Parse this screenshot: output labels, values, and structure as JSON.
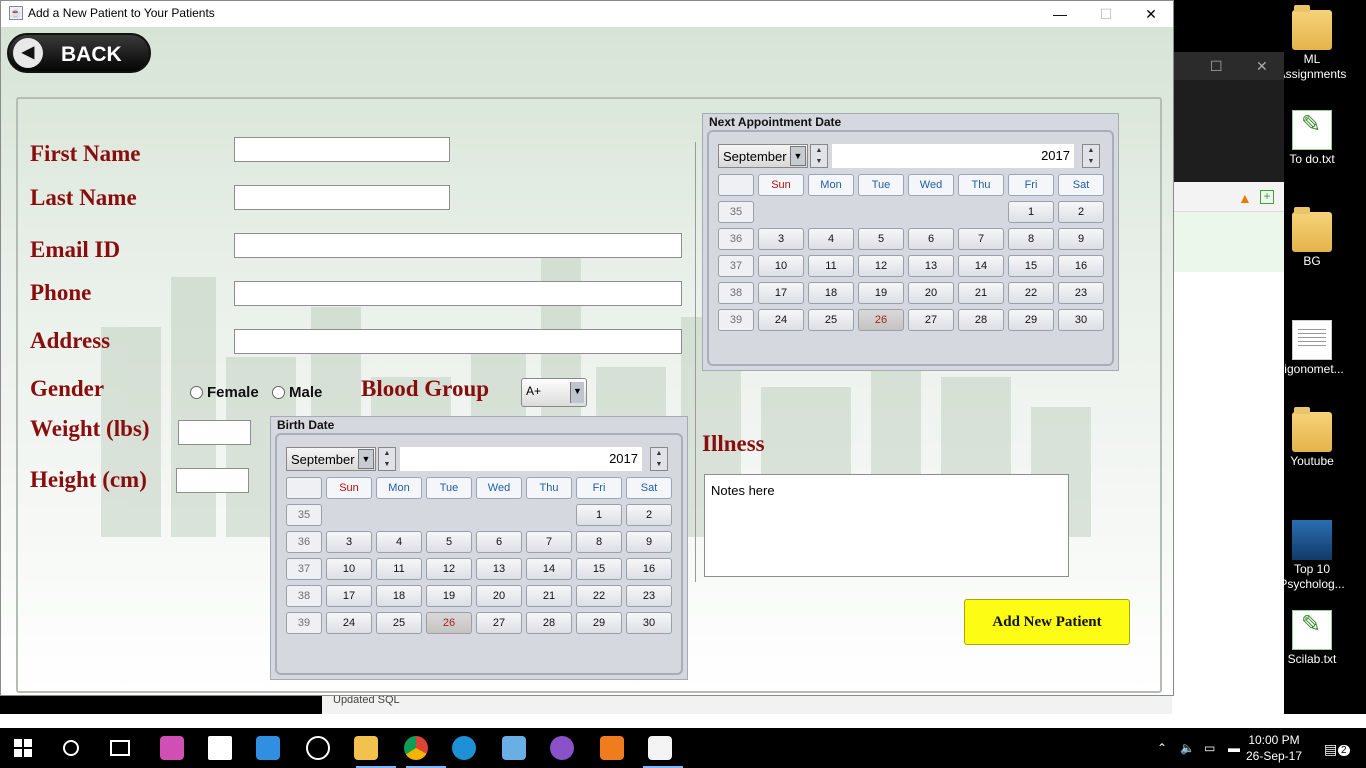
{
  "window": {
    "title": "Add a New Patient to Your Patients",
    "minimize": "—",
    "maximize": "☐",
    "close": "✕"
  },
  "back_label": "BACK",
  "form": {
    "first_name_label": "First Name",
    "last_name_label": "Last Name",
    "email_label": "Email ID",
    "phone_label": "Phone",
    "address_label": "Address",
    "gender_label": "Gender",
    "gender_options": [
      "Female",
      "Male"
    ],
    "blood_group_label": "Blood Group",
    "blood_group_value": "A+",
    "weight_label": "Weight (lbs)",
    "height_label": "Height (cm)",
    "first_name_value": "",
    "last_name_value": "",
    "email_value": "",
    "phone_value": "",
    "address_value": "",
    "weight_value": "",
    "height_value": ""
  },
  "birth_calendar": {
    "title": "Birth Date",
    "month": "September",
    "year": "2017",
    "weekdays": [
      "Sun",
      "Mon",
      "Tue",
      "Wed",
      "Thu",
      "Fri",
      "Sat"
    ],
    "weeks": [
      {
        "num": "35",
        "days": [
          "",
          "",
          "",
          "",
          "",
          "1",
          "2"
        ]
      },
      {
        "num": "36",
        "days": [
          "3",
          "4",
          "5",
          "6",
          "7",
          "8",
          "9"
        ]
      },
      {
        "num": "37",
        "days": [
          "10",
          "11",
          "12",
          "13",
          "14",
          "15",
          "16"
        ]
      },
      {
        "num": "38",
        "days": [
          "17",
          "18",
          "19",
          "20",
          "21",
          "22",
          "23"
        ]
      },
      {
        "num": "39",
        "days": [
          "24",
          "25",
          "26",
          "27",
          "28",
          "29",
          "30"
        ]
      }
    ],
    "selected_day": "26"
  },
  "appointment_calendar": {
    "title": "Next Appointment Date",
    "month": "September",
    "year": "2017",
    "weekdays": [
      "Sun",
      "Mon",
      "Tue",
      "Wed",
      "Thu",
      "Fri",
      "Sat"
    ],
    "weeks": [
      {
        "num": "35",
        "days": [
          "",
          "",
          "",
          "",
          "",
          "1",
          "2"
        ]
      },
      {
        "num": "36",
        "days": [
          "3",
          "4",
          "5",
          "6",
          "7",
          "8",
          "9"
        ]
      },
      {
        "num": "37",
        "days": [
          "10",
          "11",
          "12",
          "13",
          "14",
          "15",
          "16"
        ]
      },
      {
        "num": "38",
        "days": [
          "17",
          "18",
          "19",
          "20",
          "21",
          "22",
          "23"
        ]
      },
      {
        "num": "39",
        "days": [
          "24",
          "25",
          "26",
          "27",
          "28",
          "29",
          "30"
        ]
      }
    ],
    "selected_day": "26"
  },
  "illness": {
    "label": "Illness",
    "notes_value": "Notes here"
  },
  "add_button_label": "Add New Patient",
  "desktop_icons": [
    {
      "label": "ML Assignments",
      "icon": "folder-icon"
    },
    {
      "label": "To do.txt",
      "icon": "scilab-file-icon"
    },
    {
      "label": "BG",
      "icon": "folder-icon"
    },
    {
      "label": "rigonomet...",
      "icon": "document-icon"
    },
    {
      "label": "Youtube",
      "icon": "folder-icon"
    },
    {
      "label": "Top 10 Psycholog...",
      "icon": "video-icon"
    },
    {
      "label": "Scilab.txt",
      "icon": "scilab-file-icon"
    }
  ],
  "behind_window_text": "Updated SQL",
  "taskbar": {
    "time": "10:00 PM",
    "date": "26-Sep-17",
    "notification_count": "2"
  },
  "colors": {
    "label_red": "#8a0d0d",
    "add_button_yellow": "#fcfc14",
    "weekday_blue": "#1f5fa5"
  }
}
